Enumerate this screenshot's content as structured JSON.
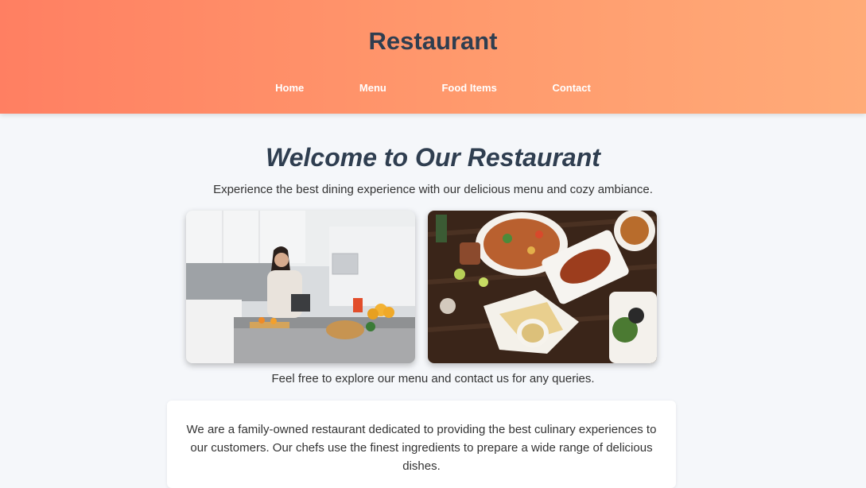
{
  "header": {
    "title": "Restaurant",
    "nav": [
      "Home",
      "Menu",
      "Food Items",
      "Contact"
    ]
  },
  "hero": {
    "title": "Welcome to Our Restaurant",
    "subtitle": "Experience the best dining experience with our delicious menu and cozy ambiance."
  },
  "photos": [
    {
      "alt": "kitchen-photo",
      "icon": "woman-cooking-in-kitchen"
    },
    {
      "alt": "food-table-photo",
      "icon": "dishes-on-wooden-table"
    }
  ],
  "explore_text": "Feel free to explore our menu and contact us for any queries.",
  "about": {
    "text": "We are a family-owned restaurant dedicated to providing the best culinary experiences to our customers. Our chefs use the finest ingredients to prepare a wide range of delicious dishes."
  },
  "colors": {
    "header_gradient_start": "#ff7f62",
    "header_gradient_end": "#ffab78",
    "title_color": "#2f3e50",
    "page_bg": "#f5f7fa"
  }
}
